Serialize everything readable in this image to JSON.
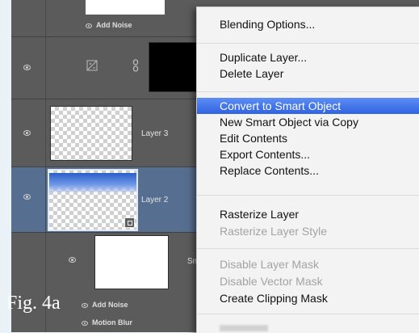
{
  "layers": {
    "top_effect": "Add Noise",
    "layer3_name": "Layer 3",
    "layer2_name": "Layer 2",
    "smart_name_partial": "Sma",
    "effects_bottom": [
      "Add Noise",
      "Motion Blur"
    ]
  },
  "context_menu": {
    "items": [
      {
        "label": "Blending Options...",
        "enabled": true
      },
      {
        "label": "Duplicate Layer...",
        "enabled": true
      },
      {
        "label": "Delete Layer",
        "enabled": true
      },
      {
        "label": "Convert to Smart Object",
        "enabled": true,
        "highlighted": true
      },
      {
        "label": "New Smart Object via Copy",
        "enabled": true
      },
      {
        "label": "Edit Contents",
        "enabled": true
      },
      {
        "label": "Export Contents...",
        "enabled": true
      },
      {
        "label": "Replace Contents...",
        "enabled": true
      },
      {
        "label": "Rasterize Layer",
        "enabled": true
      },
      {
        "label": "Rasterize Layer Style",
        "enabled": false
      },
      {
        "label": "Disable Layer Mask",
        "enabled": false
      },
      {
        "label": "Disable Vector Mask",
        "enabled": false
      },
      {
        "label": "Create Clipping Mask",
        "enabled": true
      }
    ]
  },
  "caption": "Fig. 4a",
  "colors": {
    "panel": "#5b5b5b",
    "selected_row": "#566e90",
    "menu_highlight": "#3a6fe6",
    "page_background": "#eaf2f8"
  }
}
